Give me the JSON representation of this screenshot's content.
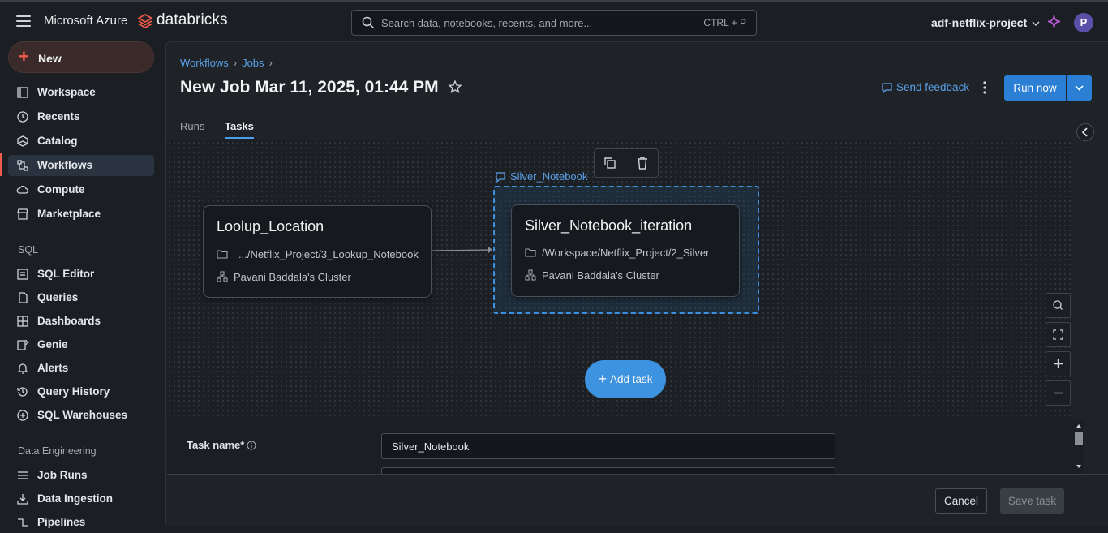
{
  "topbar": {
    "cloud_name": "Microsoft Azure",
    "brand_name": "databricks",
    "search_placeholder": "Search data, notebooks, recents, and more...",
    "search_shortcut": "CTRL + P",
    "workspace_name": "adf-netflix-project",
    "avatar_initial": "P"
  },
  "sidebar": {
    "new_label": "New",
    "items": [
      {
        "label": "Workspace",
        "icon": "workspace-icon"
      },
      {
        "label": "Recents",
        "icon": "clock-icon"
      },
      {
        "label": "Catalog",
        "icon": "catalog-icon"
      },
      {
        "label": "Workflows",
        "icon": "workflows-icon"
      },
      {
        "label": "Compute",
        "icon": "cloud-icon"
      },
      {
        "label": "Marketplace",
        "icon": "store-icon"
      }
    ],
    "sql_section": "SQL",
    "sql_items": [
      {
        "label": "SQL Editor",
        "icon": "editor-icon"
      },
      {
        "label": "Queries",
        "icon": "queries-icon"
      },
      {
        "label": "Dashboards",
        "icon": "dashboard-icon"
      },
      {
        "label": "Genie",
        "icon": "genie-icon"
      },
      {
        "label": "Alerts",
        "icon": "bell-icon"
      },
      {
        "label": "Query History",
        "icon": "history-icon"
      },
      {
        "label": "SQL Warehouses",
        "icon": "warehouse-icon"
      }
    ],
    "de_section": "Data Engineering",
    "de_items": [
      {
        "label": "Job Runs",
        "icon": "list-icon"
      },
      {
        "label": "Data Ingestion",
        "icon": "ingest-icon"
      },
      {
        "label": "Pipelines",
        "icon": "pipeline-icon"
      }
    ]
  },
  "header": {
    "breadcrumb": [
      "Workflows",
      "Jobs"
    ],
    "title": "New Job Mar 11, 2025, 01:44 PM",
    "feedback_label": "Send feedback",
    "run_now_label": "Run now"
  },
  "tabs": [
    {
      "label": "Runs",
      "active": false
    },
    {
      "label": "Tasks",
      "active": true
    }
  ],
  "dag": {
    "selected_label": "Silver_Notebook",
    "nodes": [
      {
        "title": "Loolup_Location",
        "path": ".../Netflix_Project/3_Lookup_Notebook",
        "cluster": "Pavani Baddala's Cluster"
      },
      {
        "title": "Silver_Notebook_iteration",
        "path": "/Workspace/Netflix_Project/2_Silver",
        "cluster": "Pavani Baddala's Cluster"
      }
    ],
    "add_task_label": "Add task"
  },
  "task_panel": {
    "task_name_label": "Task name*",
    "task_name_value": "Silver_Notebook"
  },
  "footer": {
    "cancel_label": "Cancel",
    "save_label": "Save task"
  },
  "colors": {
    "accent": "#2b7fd4",
    "brand_red": "#ef5b4a",
    "link": "#5aa0e6"
  }
}
